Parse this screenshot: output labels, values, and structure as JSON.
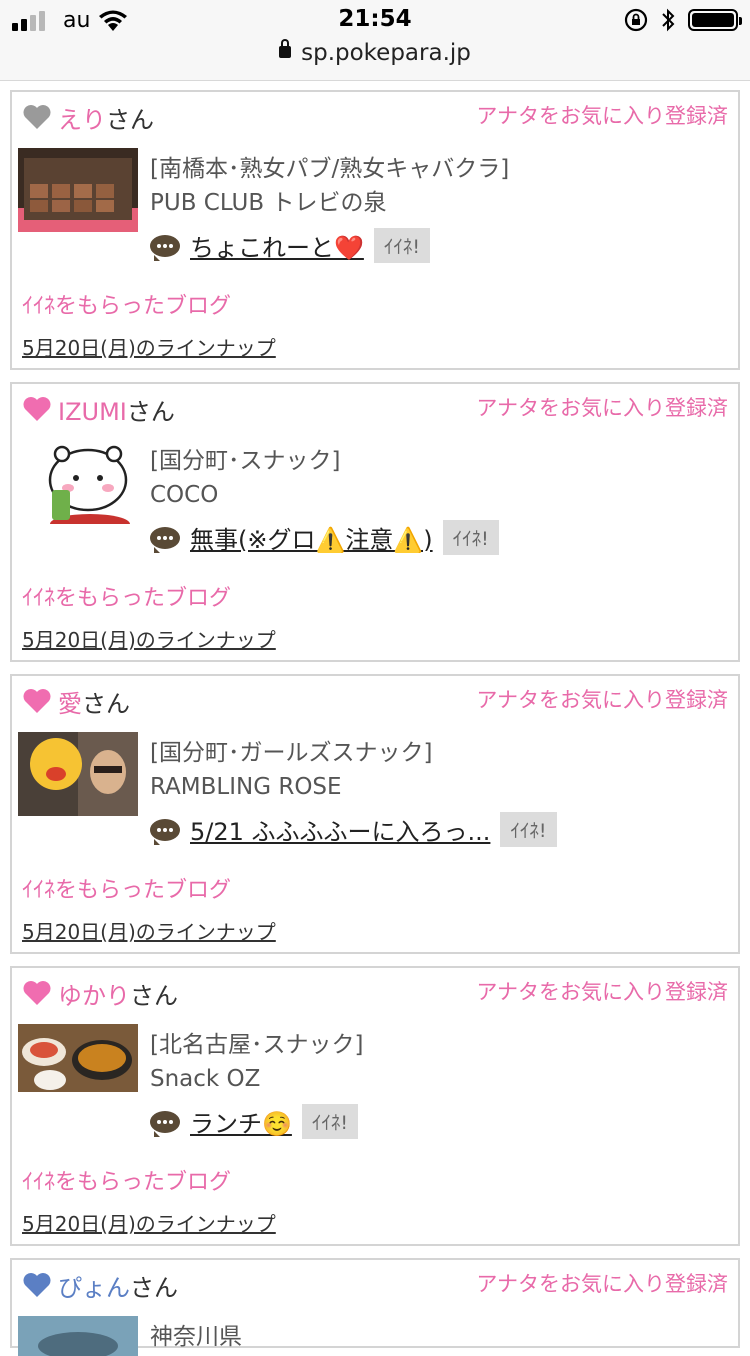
{
  "statusbar": {
    "carrier": "au",
    "time": "21:54",
    "url": "sp.pokepara.jp"
  },
  "colors": {
    "accent": "#e86aa9",
    "blue_heart": "#5b7fc4",
    "gray_heart": "#9a9a9a"
  },
  "cards": [
    {
      "heart": "gray",
      "name": "えり",
      "san": "さん",
      "fav": "アナタをお気に入り登録済",
      "area": "[南橋本･熟女パブ/熟女キャバクラ]",
      "shop": "PUB CLUB トレビの泉",
      "blog_title": "ちょこれーと❤️",
      "iine": "ｲｲﾈ!",
      "got": "ｲｲﾈをもらったブログ",
      "lineup": "5月20日(月)のラインナップ"
    },
    {
      "heart": "pink",
      "name": "IZUMI",
      "san": "さん",
      "fav": "アナタをお気に入り登録済",
      "area": "[国分町･スナック]",
      "shop": "COCO",
      "blog_title": "無事(※グロ⚠️注意⚠️)",
      "iine": "ｲｲﾈ!",
      "got": "ｲｲﾈをもらったブログ",
      "lineup": "5月20日(月)のラインナップ"
    },
    {
      "heart": "pink",
      "name": "愛",
      "san": "さん",
      "fav": "アナタをお気に入り登録済",
      "area": "[国分町･ガールズスナック]",
      "shop": "RAMBLING ROSE",
      "blog_title": "5/21 ふふふふーに入ろっ...",
      "iine": "ｲｲﾈ!",
      "got": "ｲｲﾈをもらったブログ",
      "lineup": "5月20日(月)のラインナップ"
    },
    {
      "heart": "pink",
      "name": "ゆかり",
      "san": "さん",
      "fav": "アナタをお気に入り登録済",
      "area": "[北名古屋･スナック]",
      "shop": "Snack OZ",
      "blog_title": "ランチ☺️",
      "iine": "ｲｲﾈ!",
      "got": "ｲｲﾈをもらったブログ",
      "lineup": "5月20日(月)のラインナップ"
    },
    {
      "heart": "blue",
      "name": "ぴょん",
      "san": "さん",
      "fav": "アナタをお気に入り登録済",
      "area": "神奈川県",
      "shop": "",
      "blog_title": "",
      "iine": "",
      "got": "",
      "lineup": ""
    }
  ]
}
